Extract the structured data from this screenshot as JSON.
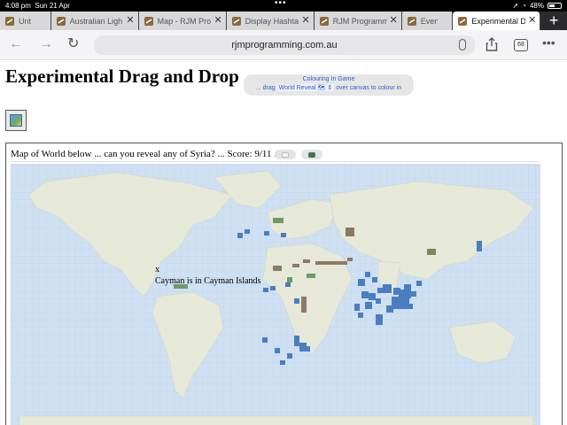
{
  "status": {
    "time": "4:08 pm",
    "date": "Sun 21 Apr",
    "battery": "48%"
  },
  "tabs": [
    {
      "label": "Unt",
      "active": false
    },
    {
      "label": "Australian Ligh",
      "active": false
    },
    {
      "label": "Map - RJM Pro",
      "active": false
    },
    {
      "label": "Display Hashta",
      "active": false
    },
    {
      "label": "RJM Programm",
      "active": false
    },
    {
      "label": "Event C",
      "active": false
    },
    {
      "label": "Experimental D",
      "active": true
    }
  ],
  "toolbar": {
    "url": "rjmprogramming.com.au",
    "tab_count": "68",
    "back_icon": "back-arrow-icon",
    "forward_icon": "forward-arrow-icon",
    "reload_icon": "reload-icon",
    "share_icon": "share-icon",
    "more_icon": "more-icon"
  },
  "page": {
    "title": "Experimental Drag and Drop",
    "game": {
      "heading": "Colouring In Game",
      "prefix": "... drag",
      "selected": "World Reveal 🗺",
      "suffix": "over canvas to colour in"
    },
    "map": {
      "title": "Map of World below ... can you reveal any of Syria? ... Score: 9/11 ...",
      "score": "9/11",
      "target_country": "Syria",
      "close_mark": "x",
      "message": "Cayman is in Cayman Islands"
    }
  },
  "colors": {
    "ocean": "#c9dcf0",
    "land": "#e8eadb",
    "revealed_blue": "#4a7ec2",
    "revealed_green": "#5b8a5a",
    "revealed_brown": "#8a7a62"
  }
}
